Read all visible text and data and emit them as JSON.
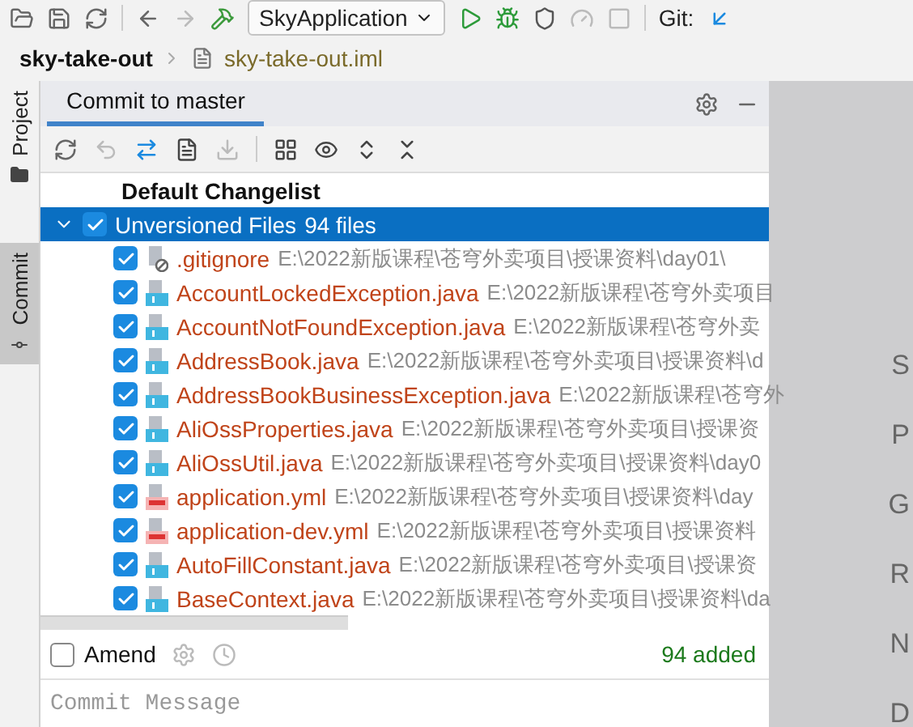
{
  "toolbar": {
    "run_config": "SkyApplication",
    "git_label": "Git:"
  },
  "breadcrumb": {
    "project": "sky-take-out",
    "file": "sky-take-out.iml"
  },
  "side_tabs": [
    {
      "label": "Project",
      "selected": false
    },
    {
      "label": "Commit",
      "selected": true
    }
  ],
  "panel": {
    "tab": "Commit to master"
  },
  "tree": {
    "changelist": "Default Changelist",
    "group": {
      "label": "Unversioned Files",
      "count": "94 files",
      "checked": true,
      "expanded": true,
      "selected": true
    },
    "files": [
      {
        "name": ".gitignore",
        "path": "E:\\2022新版课程\\苍穹外卖项目\\授课资料\\day01\\",
        "kind": "ignore",
        "checked": true
      },
      {
        "name": "AccountLockedException.java",
        "path": "E:\\2022新版课程\\苍穹外卖项目",
        "kind": "java",
        "checked": true
      },
      {
        "name": "AccountNotFoundException.java",
        "path": "E:\\2022新版课程\\苍穹外卖",
        "kind": "java",
        "checked": true
      },
      {
        "name": "AddressBook.java",
        "path": "E:\\2022新版课程\\苍穹外卖项目\\授课资料\\d",
        "kind": "java",
        "checked": true
      },
      {
        "name": "AddressBookBusinessException.java",
        "path": "E:\\2022新版课程\\苍穹外",
        "kind": "java",
        "checked": true
      },
      {
        "name": "AliOssProperties.java",
        "path": "E:\\2022新版课程\\苍穹外卖项目\\授课资",
        "kind": "java",
        "checked": true
      },
      {
        "name": "AliOssUtil.java",
        "path": "E:\\2022新版课程\\苍穹外卖项目\\授课资料\\day0",
        "kind": "java",
        "checked": true
      },
      {
        "name": "application.yml",
        "path": "E:\\2022新版课程\\苍穹外卖项目\\授课资料\\day",
        "kind": "yml",
        "checked": true
      },
      {
        "name": "application-dev.yml",
        "path": "E:\\2022新版课程\\苍穹外卖项目\\授课资料",
        "kind": "yml",
        "checked": true
      },
      {
        "name": "AutoFillConstant.java",
        "path": "E:\\2022新版课程\\苍穹外卖项目\\授课资",
        "kind": "java",
        "checked": true
      },
      {
        "name": "BaseContext.java",
        "path": "E:\\2022新版课程\\苍穹外卖项目\\授课资料\\da",
        "kind": "java",
        "checked": true
      }
    ]
  },
  "amend": {
    "label": "Amend",
    "checked": false
  },
  "summary": "94 added",
  "message": {
    "placeholder": "Commit Message"
  },
  "right_panel_letters": [
    "S",
    "P",
    "G",
    "R",
    "N",
    "D"
  ]
}
